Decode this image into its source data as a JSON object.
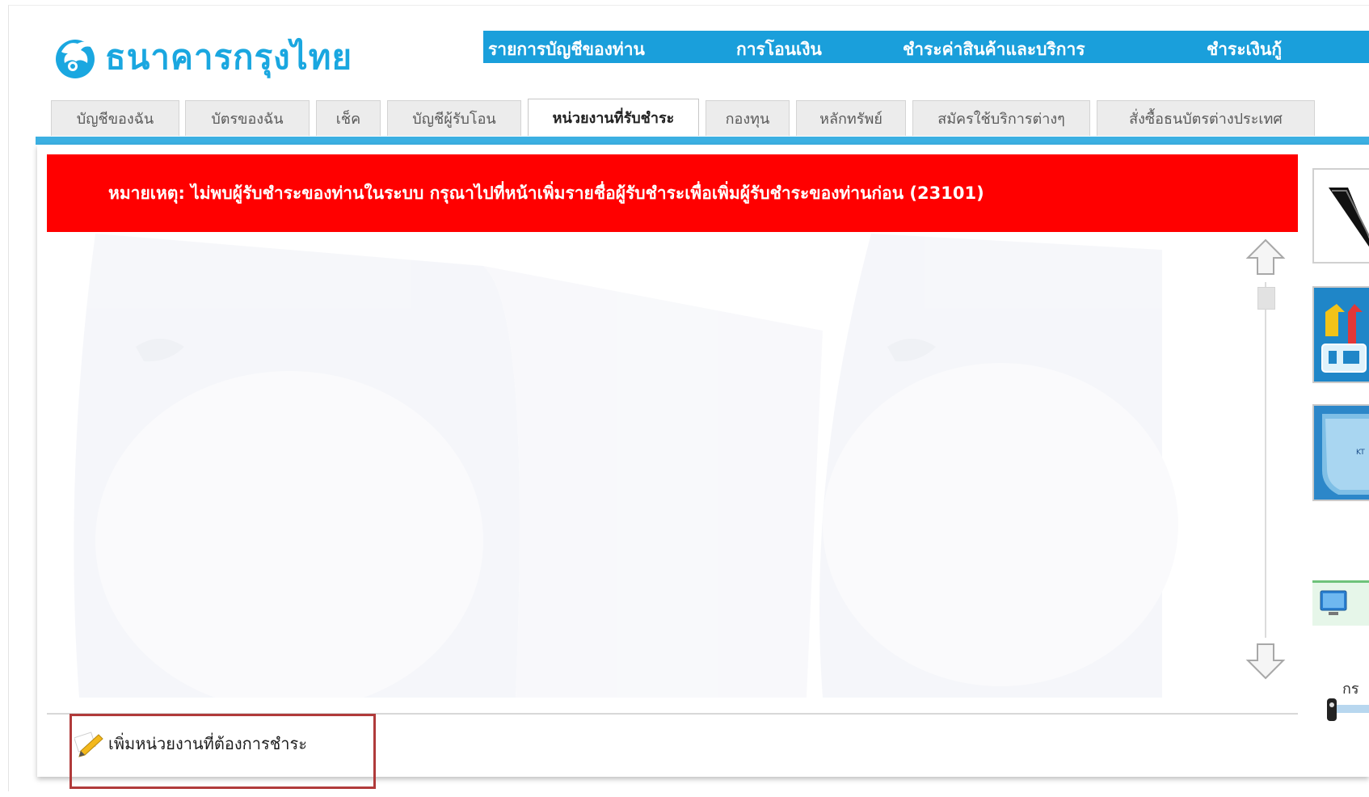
{
  "brand": {
    "name": "ธนาคารกรุงไทย",
    "color": "#1aa7e0",
    "icon": "krungthai-bird-icon"
  },
  "topnav": {
    "color": "#1a9fdb",
    "items": [
      {
        "label": "รายการบัญชีของท่าน"
      },
      {
        "label": "การโอนเงิน"
      },
      {
        "label": "ชำระค่าสินค้าและบริการ"
      },
      {
        "label": "ชำระเงินกู้"
      }
    ]
  },
  "tabs": [
    {
      "label": "บัญชีของฉัน",
      "active": false
    },
    {
      "label": "บัตรของฉัน",
      "active": false
    },
    {
      "label": "เช็ค",
      "active": false
    },
    {
      "label": "บัญชีผู้รับโอน",
      "active": false
    },
    {
      "label": "หน่วยงานที่รับชำระ",
      "active": true
    },
    {
      "label": "กองทุน",
      "active": false
    },
    {
      "label": "หลักทรัพย์",
      "active": false
    },
    {
      "label": "สมัครใช้บริการต่างๆ",
      "active": false
    },
    {
      "label": "สั่งซื้อธนบัตรต่างประเทศ",
      "active": false
    }
  ],
  "alert": {
    "text": "หมายเหตุ: ไม่พบผู้รับชำระของท่านในระบบ กรุณาไปที่หน้าเพิ่มรายชื่อผู้รับชำระเพื่อเพิ่มผู้รับชำระของท่านก่อน (23101)",
    "color": "#ff0000"
  },
  "actions": {
    "add_payee_label": "เพิ่มหน่วยงานที่ต้องการชำระ",
    "add_payee_icon": "pencil-icon"
  },
  "sidebar": {
    "partial_text": "กร"
  }
}
